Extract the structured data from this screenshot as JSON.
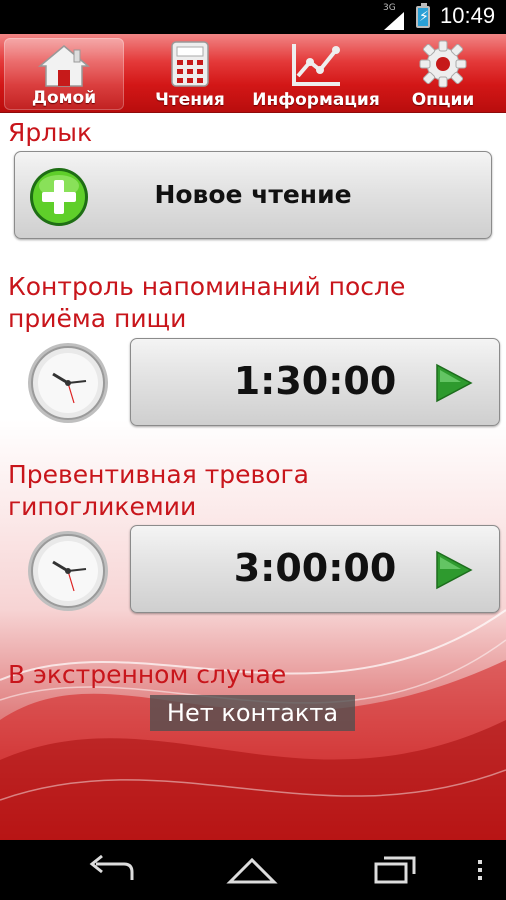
{
  "status_bar": {
    "network": "3G",
    "time": "10:49"
  },
  "tabs": [
    {
      "label": "Домой",
      "icon": "home-icon",
      "active": true
    },
    {
      "label": "Чтения",
      "icon": "calculator-icon",
      "active": false
    },
    {
      "label": "Информация",
      "icon": "line-chart-icon",
      "active": false
    },
    {
      "label": "Опции",
      "icon": "gear-icon",
      "active": false
    }
  ],
  "shortcut": {
    "title": "Ярлык",
    "new_reading_label": "Новое чтение"
  },
  "post_meal_reminder": {
    "title_line1": "Контроль напоминаний после",
    "title_line2": "приёма пищи",
    "time": "1:30:00"
  },
  "hypo_alarm": {
    "title_line1": "Превентивная тревога",
    "title_line2": "гипогликемии",
    "time": "3:00:00"
  },
  "emergency": {
    "title": "В экстренном случае",
    "contact": "Нет контакта"
  },
  "colors": {
    "accent": "#c8151b",
    "tabbar": "#d31717",
    "play": "#3aa43a"
  }
}
